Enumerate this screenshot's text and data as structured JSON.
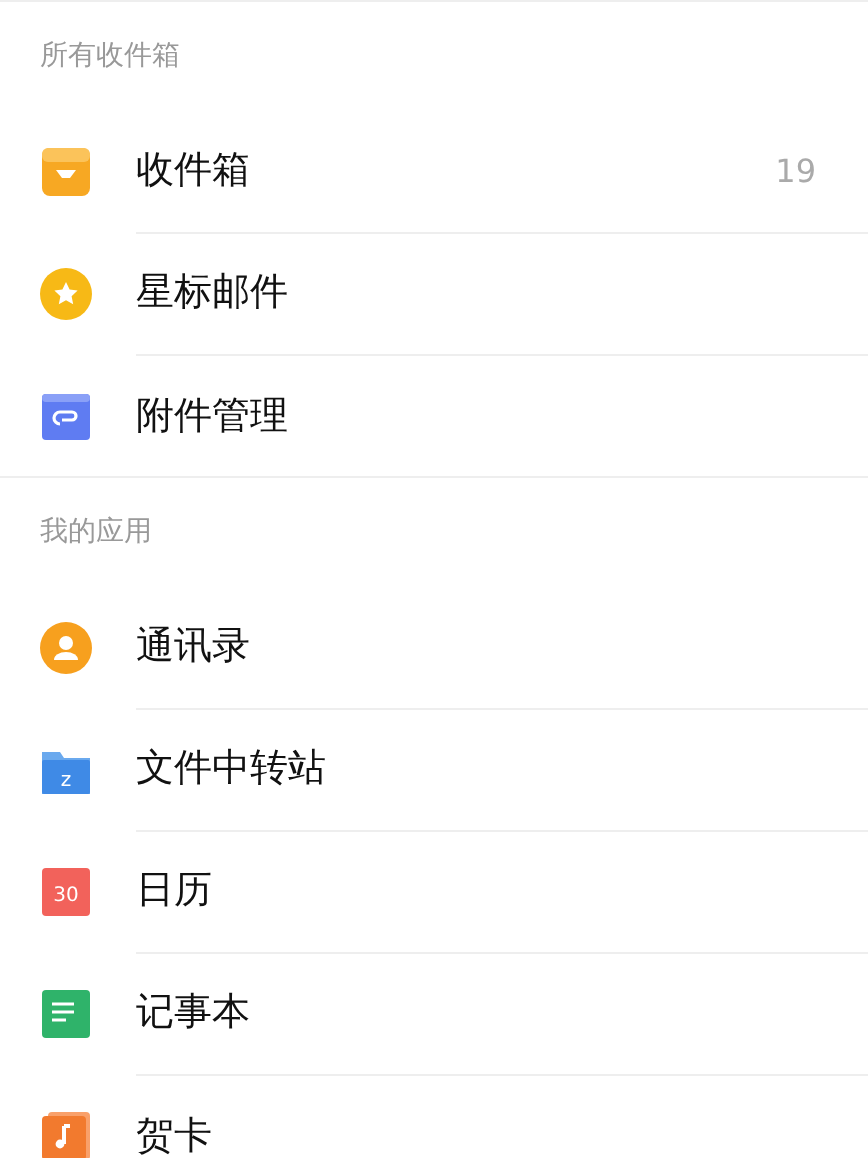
{
  "sections": [
    {
      "header": "所有收件箱",
      "items": [
        {
          "kind": "inbox",
          "label": "收件箱",
          "count": "19"
        },
        {
          "kind": "star",
          "label": "星标邮件"
        },
        {
          "kind": "attachment",
          "label": "附件管理"
        }
      ]
    },
    {
      "header": "我的应用",
      "items": [
        {
          "kind": "contacts",
          "label": "通讯录"
        },
        {
          "kind": "folder",
          "label": "文件中转站",
          "badge": "z"
        },
        {
          "kind": "calendar",
          "label": "日历",
          "badge": "30"
        },
        {
          "kind": "notes",
          "label": "记事本"
        },
        {
          "kind": "card",
          "label": "贺卡"
        }
      ]
    }
  ]
}
